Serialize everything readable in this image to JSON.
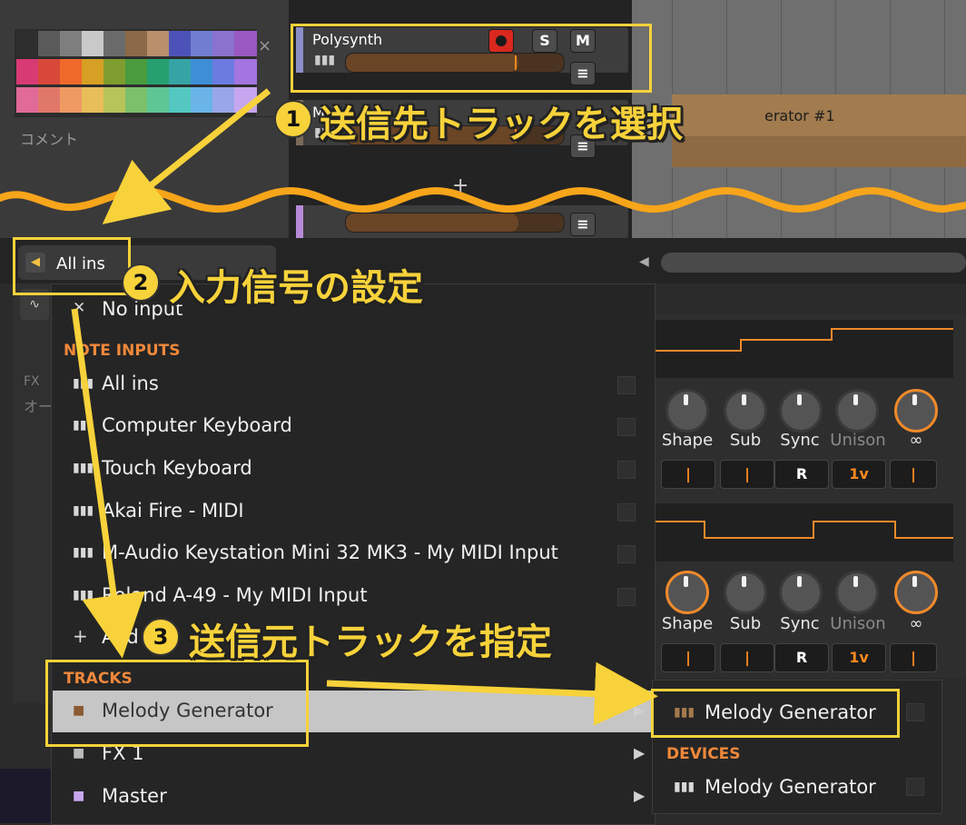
{
  "palette": {
    "close_icon": "×",
    "rows": [
      [
        "#2e2e2e",
        "#5a5a5a",
        "#7e7e7e",
        "#c9c9c9",
        "#6b6b6b",
        "#8b6a48",
        "#b98f6c",
        "#4d52b8",
        "#6f7ed0",
        "#8a72cf",
        "#9a58c2"
      ],
      [
        "#d83a74",
        "#d8483a",
        "#ef6a2a",
        "#d6a024",
        "#7f9d2f",
        "#4a9a3e",
        "#25a06e",
        "#36a4a5",
        "#3e8ed6",
        "#6c7be0",
        "#a474e0"
      ],
      [
        "#e06a98",
        "#e0786a",
        "#ef9a62",
        "#e8be5a",
        "#b6c45a",
        "#7cc06c",
        "#5ec694",
        "#54c8c0",
        "#6ab4e8",
        "#9aa6ea",
        "#c6a6ee"
      ]
    ]
  },
  "comment_label": "コメント",
  "tracks": [
    {
      "name": "Polysynth",
      "btn_s": "S",
      "btn_m": "M"
    },
    {
      "name": "M"
    },
    {
      "name": ""
    }
  ],
  "add_track": "+",
  "clip_label": "erator #1",
  "input_selector": {
    "value": "All ins"
  },
  "fx_label": "FX",
  "fx_sub": "オー",
  "menu": {
    "no_input": "No input",
    "note_inputs_header": "NOTE INPUTS",
    "note_inputs": [
      "All ins",
      "Computer Keyboard",
      "Touch Keyboard",
      "Akai Fire - MIDI",
      "M-Audio Keystation Mini 32 MK3 - My MIDI Input",
      "Roland A-49 - My MIDI Input"
    ],
    "add_item": "Add",
    "tracks_header": "TRACKS",
    "tracks": [
      "Melody Generator",
      "FX 1",
      "Master"
    ]
  },
  "submenu": {
    "item": "Melody Generator",
    "devices_header": "DEVICES",
    "device_item": "Melody Generator"
  },
  "device": {
    "knob_labels": [
      "Shape",
      "Sub",
      "Sync",
      "Unison"
    ],
    "ctl_r": "R",
    "ctl_1v": "1v"
  },
  "annotations": {
    "step1_num": "1",
    "step1_text": "送信先トラックを選択",
    "step2_num": "2",
    "step2_text": "入力信号の設定",
    "step3_num": "3",
    "step3_text": "送信元トラックを指定"
  },
  "colors": {
    "accent": "#f7d23a",
    "orange": "#ff8a1e",
    "record": "#d9281e"
  }
}
